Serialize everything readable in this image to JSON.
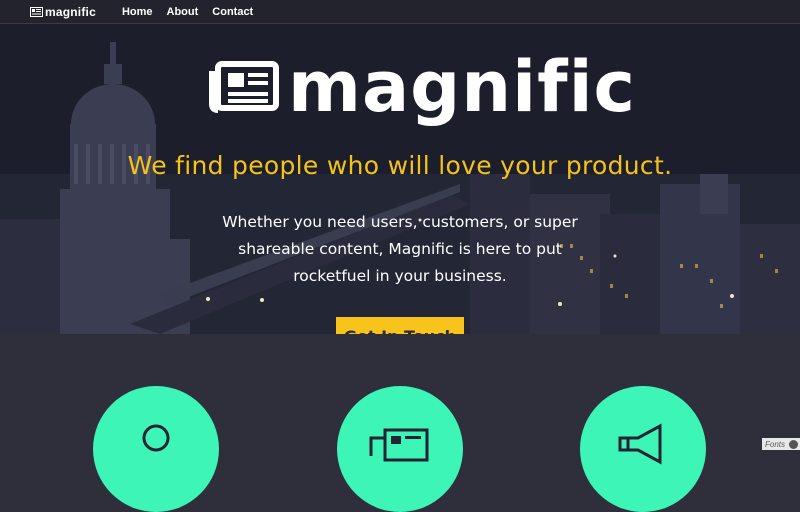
{
  "nav": {
    "brand": "magnific",
    "links": [
      "Home",
      "About",
      "Contact"
    ]
  },
  "hero": {
    "logo_text": "magnific",
    "tagline": "We find people who will love your product.",
    "description": "Whether you need users, customers, or super shareable content, Magnific is here to put rocketfuel in your business.",
    "cta_label": "Get In Touch"
  },
  "features": {
    "icons": [
      "person-icon",
      "newspaper-icon",
      "megaphone-icon"
    ]
  },
  "badge": {
    "label": "Fonts"
  },
  "colors": {
    "accent_yellow": "#f8c31b",
    "tagline_yellow": "#f4c21b",
    "feature_green": "#3ef5b8",
    "background": "#2f2f3b"
  }
}
